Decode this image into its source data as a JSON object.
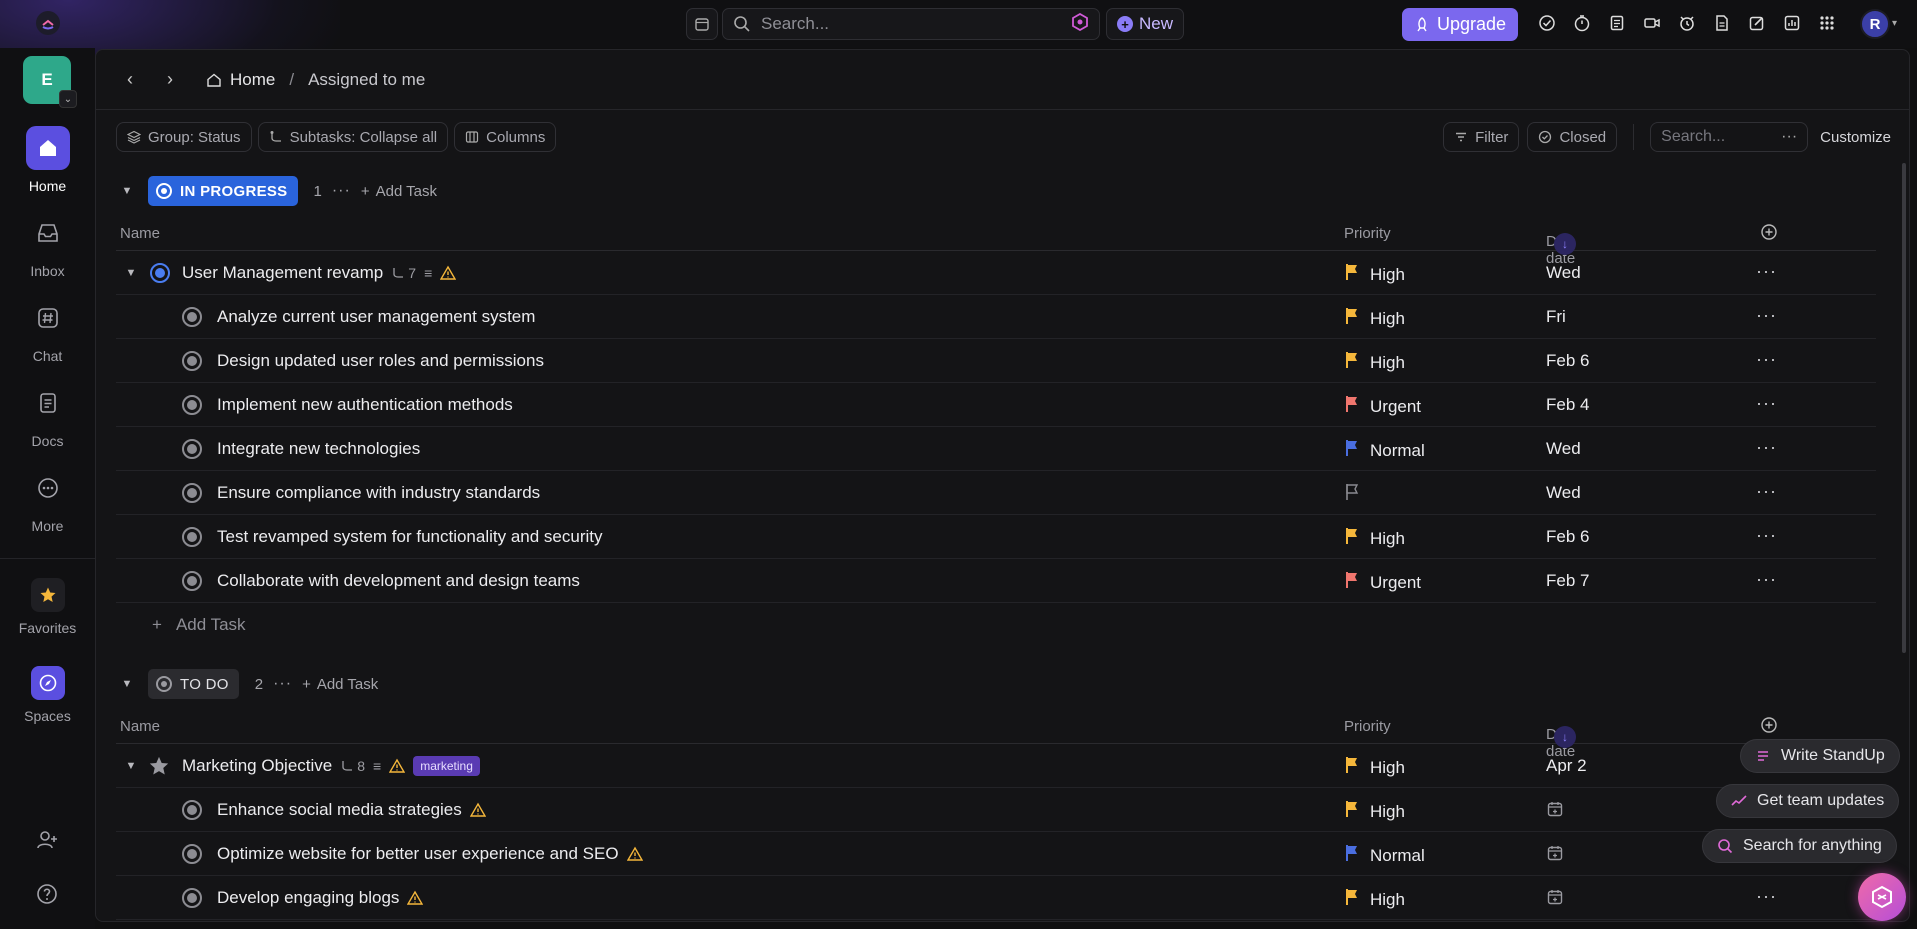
{
  "topbar": {
    "search_placeholder": "Search...",
    "new_label": "New",
    "upgrade_label": "Upgrade",
    "avatar_initial": "R"
  },
  "workspace": {
    "initial": "E"
  },
  "rail": {
    "items": [
      {
        "label": "Home",
        "icon": "home-icon"
      },
      {
        "label": "Inbox",
        "icon": "inbox-icon"
      },
      {
        "label": "Chat",
        "icon": "hash-icon"
      },
      {
        "label": "Docs",
        "icon": "doc-icon"
      },
      {
        "label": "More",
        "icon": "more-icon"
      },
      {
        "label": "Favorites",
        "icon": "star-icon"
      },
      {
        "label": "Spaces",
        "icon": "compass-icon"
      }
    ]
  },
  "breadcrumb": {
    "home": "Home",
    "separator": "/",
    "current": "Assigned to me"
  },
  "toolbar": {
    "group": "Group: Status",
    "subtasks": "Subtasks: Collapse all",
    "columns": "Columns",
    "filter": "Filter",
    "closed": "Closed",
    "search_placeholder": "Search...",
    "customize": "Customize"
  },
  "columns": {
    "name": "Name",
    "priority": "Priority",
    "due": "Due date"
  },
  "groups": [
    {
      "status": "IN PROGRESS",
      "count": "1",
      "add_task": "Add Task",
      "parent": {
        "name": "User Management revamp",
        "subtasks": "7",
        "priority": "High",
        "due": "Wed"
      },
      "rows": [
        {
          "name": "Analyze current user management system",
          "priority": "High",
          "due": "Fri"
        },
        {
          "name": "Design updated user roles and permissions",
          "priority": "High",
          "due": "Feb 6"
        },
        {
          "name": "Implement new authentication methods",
          "priority": "Urgent",
          "due": "Feb 4"
        },
        {
          "name": "Integrate new technologies",
          "priority": "Normal",
          "due": "Wed"
        },
        {
          "name": "Ensure compliance with industry standards",
          "priority": "",
          "due": "Wed"
        },
        {
          "name": "Test revamped system for functionality and security",
          "priority": "High",
          "due": "Feb 6"
        },
        {
          "name": "Collaborate with development and design teams",
          "priority": "Urgent",
          "due": "Feb 7"
        }
      ],
      "add_row": "Add Task"
    },
    {
      "status": "TO DO",
      "count": "2",
      "add_task": "Add Task",
      "parent": {
        "name": "Marketing Objective",
        "subtasks": "8",
        "tag": "marketing",
        "priority": "High",
        "due": "Apr 2"
      },
      "rows": [
        {
          "name": "Enhance social media strategies",
          "priority": "High",
          "due": ""
        },
        {
          "name": "Optimize website for better user experience and SEO",
          "priority": "Normal",
          "due": ""
        },
        {
          "name": "Develop engaging blogs",
          "priority": "High",
          "due": ""
        }
      ]
    }
  ],
  "ai": {
    "write_standup": "Write StandUp",
    "team_updates": "Get team updates",
    "search_anything": "Search for anything"
  },
  "colors": {
    "high": "#f5b73b",
    "urgent": "#f0766e",
    "normal": "#4a6ee0",
    "accent": "#7b68ee",
    "in_progress": "#2a64dc"
  }
}
